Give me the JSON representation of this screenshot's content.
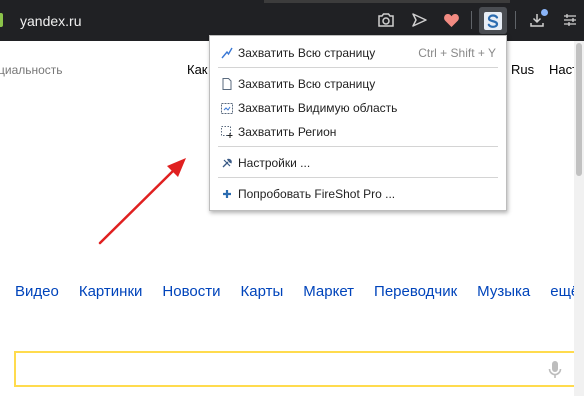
{
  "browser": {
    "url": "yandex.ru",
    "icons": [
      "camera-icon",
      "send-icon",
      "heart-icon",
      "fireshot-icon",
      "download-icon",
      "menu-icon"
    ],
    "colors": {
      "toolbar": "#202124",
      "heart": "#f28b82",
      "fireshot_logo": "#2b6cb0"
    }
  },
  "page": {
    "top_text_left": "циальность",
    "top_text_kak": "Как",
    "top_text_lang": "Rus",
    "top_text_right": "Наст",
    "services": [
      "Видео",
      "Картинки",
      "Новости",
      "Карты",
      "Маркет",
      "Переводчик",
      "Музыка",
      "ещё"
    ],
    "search": {
      "value": "",
      "placeholder": ""
    },
    "colors": {
      "link": "#0044bb",
      "search_border": "#ffdb4d"
    }
  },
  "menu": {
    "items": [
      {
        "label": "Захватить Всю страницу",
        "shortcut": "Ctrl + Shift + Y",
        "icon": "capture-full-page-highlight-icon"
      },
      {
        "label": "Захватить Всю страницу",
        "shortcut": "",
        "icon": "page-icon"
      },
      {
        "label": "Захватить Видимую область",
        "shortcut": "",
        "icon": "visible-area-icon"
      },
      {
        "label": "Захватить Регион",
        "shortcut": "",
        "icon": "region-icon"
      },
      {
        "label": "Настройки ...",
        "shortcut": "",
        "icon": "settings-tools-icon"
      },
      {
        "label": "Попробовать FireShot Pro ...",
        "shortcut": "",
        "icon": "plus-icon"
      }
    ]
  },
  "annotation": {
    "arrow_color": "#e02020"
  }
}
